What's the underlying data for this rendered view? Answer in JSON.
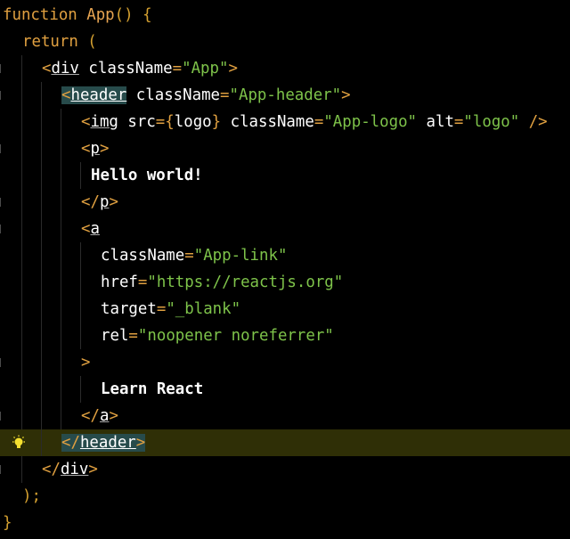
{
  "editor": {
    "lines": [
      {
        "id": "l1",
        "tokens": [
          [
            "kw",
            "function"
          ],
          [
            "fn",
            " App"
          ],
          [
            "punc",
            "() {"
          ]
        ]
      },
      {
        "id": "l2",
        "tokens": [
          [
            "kw",
            "return"
          ],
          [
            "punc",
            " ("
          ]
        ]
      },
      {
        "id": "l3",
        "tokens": [
          [
            "tagb",
            "<"
          ],
          [
            "tag",
            "div"
          ],
          [
            "attr",
            " className"
          ],
          [
            "eq",
            "="
          ],
          [
            "str",
            "\"App\""
          ],
          [
            "tagb",
            ">"
          ]
        ]
      },
      {
        "id": "l4",
        "tokens": [
          [
            "tagb-hl",
            "<"
          ],
          [
            "tag-hl",
            "header"
          ],
          [
            "attr",
            " className"
          ],
          [
            "eq",
            "="
          ],
          [
            "str",
            "\"App-header\""
          ],
          [
            "tagb",
            ">"
          ]
        ]
      },
      {
        "id": "l5",
        "tokens": [
          [
            "tagb",
            "<"
          ],
          [
            "tag",
            "img"
          ],
          [
            "attr",
            " src"
          ],
          [
            "eq",
            "="
          ],
          [
            "bracket",
            "{"
          ],
          [
            "attr",
            "logo"
          ],
          [
            "bracket",
            "}"
          ],
          [
            "attr",
            " className"
          ],
          [
            "eq",
            "="
          ],
          [
            "str",
            "\"App-logo\""
          ],
          [
            "attr",
            " alt"
          ],
          [
            "eq",
            "="
          ],
          [
            "str",
            "\"logo\""
          ],
          [
            "tagb",
            " />"
          ]
        ]
      },
      {
        "id": "l6",
        "tokens": [
          [
            "tagb",
            "<"
          ],
          [
            "tag",
            "p"
          ],
          [
            "tagb",
            ">"
          ]
        ]
      },
      {
        "id": "l7",
        "tokens": [
          [
            "txt",
            "Hello world!"
          ]
        ]
      },
      {
        "id": "l8",
        "tokens": [
          [
            "tagb",
            "</"
          ],
          [
            "tag",
            "p"
          ],
          [
            "tagb",
            ">"
          ]
        ]
      },
      {
        "id": "l9",
        "tokens": [
          [
            "tagb",
            "<"
          ],
          [
            "tag",
            "a"
          ]
        ]
      },
      {
        "id": "l10",
        "tokens": [
          [
            "attr",
            "className"
          ],
          [
            "eq",
            "="
          ],
          [
            "str",
            "\"App-link\""
          ]
        ]
      },
      {
        "id": "l11",
        "tokens": [
          [
            "attr",
            "href"
          ],
          [
            "eq",
            "="
          ],
          [
            "str",
            "\"https://reactjs.org\""
          ]
        ]
      },
      {
        "id": "l12",
        "tokens": [
          [
            "attr",
            "target"
          ],
          [
            "eq",
            "="
          ],
          [
            "str",
            "\"_blank\""
          ]
        ]
      },
      {
        "id": "l13",
        "tokens": [
          [
            "attr",
            "rel"
          ],
          [
            "eq",
            "="
          ],
          [
            "str",
            "\"noopener noreferrer\""
          ]
        ]
      },
      {
        "id": "l14",
        "tokens": [
          [
            "tagb",
            ">"
          ]
        ]
      },
      {
        "id": "l15",
        "tokens": [
          [
            "txt",
            "Learn React"
          ]
        ]
      },
      {
        "id": "l16",
        "tokens": [
          [
            "tagb",
            "</"
          ],
          [
            "tag",
            "a"
          ],
          [
            "tagb",
            ">"
          ]
        ]
      },
      {
        "id": "l17",
        "tokens": [
          [
            "tagb-hl",
            "</"
          ],
          [
            "tag-hl",
            "header"
          ],
          [
            "tagb-hl",
            ">"
          ]
        ]
      },
      {
        "id": "l18",
        "tokens": [
          [
            "tagb",
            "</"
          ],
          [
            "tag",
            "div"
          ],
          [
            "tagb",
            ">"
          ]
        ]
      },
      {
        "id": "l19",
        "tokens": [
          [
            "punc",
            ");"
          ]
        ]
      },
      {
        "id": "l20",
        "tokens": [
          [
            "punc",
            "}"
          ]
        ]
      }
    ],
    "current_line": "l17",
    "intention_icon": "lightbulb-icon",
    "colors": {
      "background": "#000000",
      "current_line": "#2f2f06",
      "keyword": "#e0a040",
      "string": "#7ec34a",
      "tag_highlight": "#274b4b",
      "bulb": "#f5e030"
    }
  }
}
